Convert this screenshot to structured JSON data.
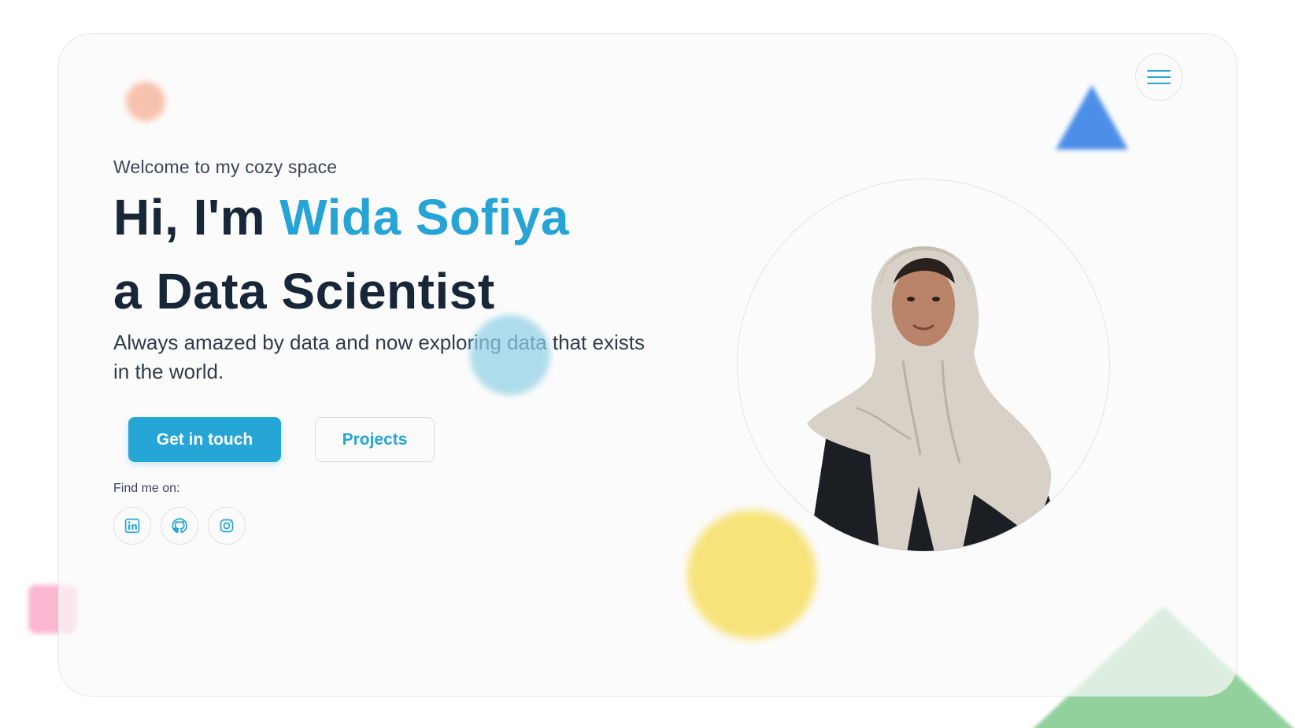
{
  "nav": {
    "menu_icon": "hamburger-menu-icon"
  },
  "hero": {
    "welcome": "Welcome to my cozy space",
    "greeting": "Hi, I'm ",
    "name": "Wida Sofiya",
    "role": "a Data Scientist",
    "tagline": "Always amazed by data and now exploring data that exists in the world."
  },
  "actions": {
    "primary_label": "Get in touch",
    "secondary_label": "Projects"
  },
  "socials": {
    "label": "Find me on:",
    "items": [
      {
        "icon": "linkedin-icon"
      },
      {
        "icon": "github-icon"
      },
      {
        "icon": "instagram-icon"
      }
    ]
  },
  "profile": {
    "image": "profile-photo"
  },
  "colors": {
    "accent": "#26a4d6",
    "heading": "#172638",
    "text": "#2f3b4d",
    "deco_peach": "#f7b49a",
    "deco_blue": "#4d8fe8",
    "deco_cyan": "#8fd0e6",
    "deco_yellow": "#f7e37a",
    "deco_pink": "#fbb6d1",
    "deco_green": "#7fc98d"
  }
}
